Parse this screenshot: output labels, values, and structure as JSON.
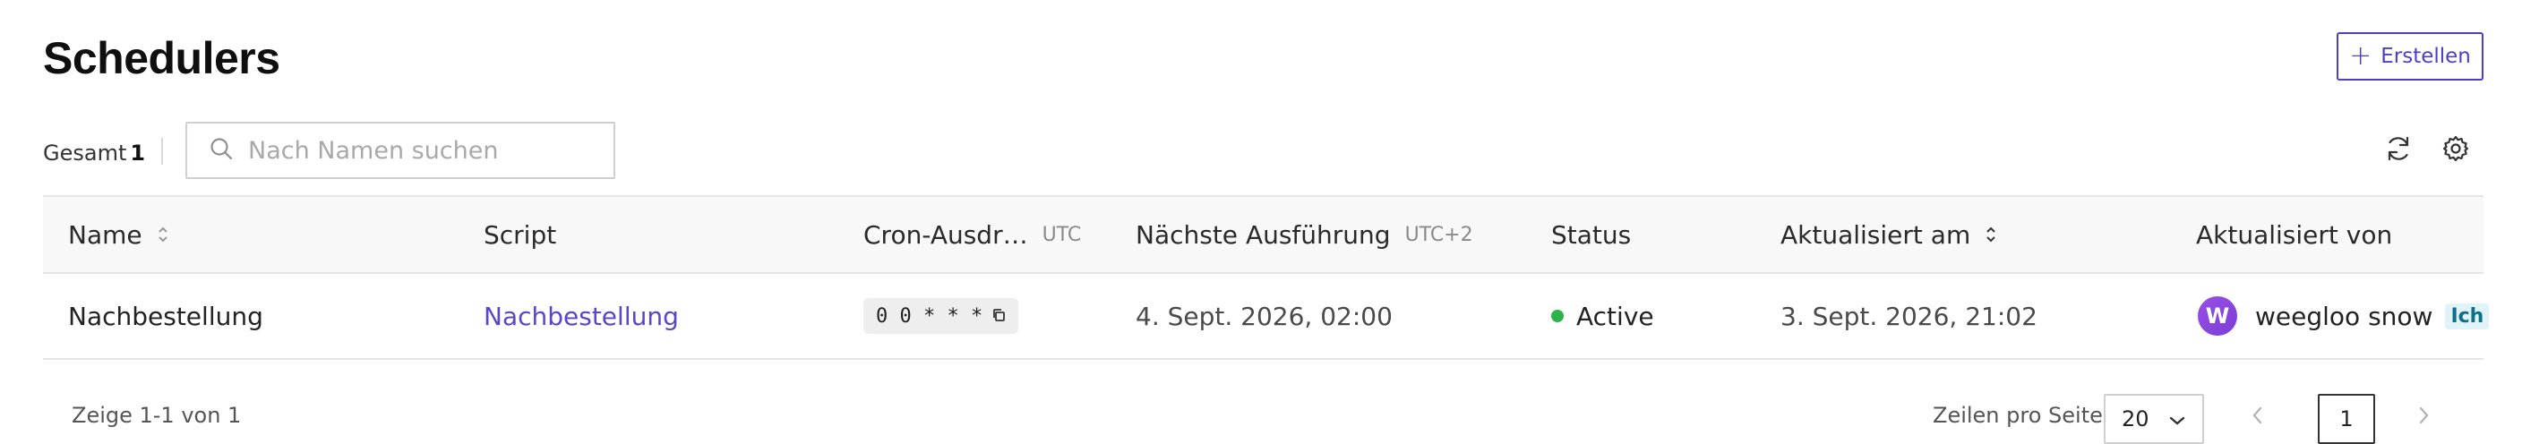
{
  "header": {
    "title": "Schedulers",
    "create_label": "Erstellen"
  },
  "toolbar": {
    "total_label": "Gesamt",
    "total_count": "1",
    "search_placeholder": "Nach Namen suchen",
    "search_value": ""
  },
  "table": {
    "columns": {
      "name": "Name",
      "script": "Script",
      "cron": "Cron-Ausdr…",
      "cron_tz": "UTC",
      "next_run": "Nächste Ausführung",
      "next_run_tz": "UTC+2",
      "status": "Status",
      "updated_at": "Aktualisiert am",
      "updated_by": "Aktualisiert von"
    },
    "rows": [
      {
        "name": "Nachbestellung",
        "script": "Nachbestellung",
        "cron": "0 0 * * *",
        "next_run": "4. Sept. 2026, 02:00",
        "status": "Active",
        "updated_at": "3. Sept. 2026, 21:02",
        "updated_by": "weegloo snow",
        "avatar_letter": "W",
        "me_badge": "Ich"
      }
    ]
  },
  "footer": {
    "range_text": "Zeige 1-1 von 1",
    "rows_per_page_label": "Zeilen pro Seite",
    "rows_per_page_value": "20",
    "current_page": "1"
  },
  "colors": {
    "accent": "#4b3fc7",
    "status_active": "#2db34a",
    "badge_bg": "#dff3f8"
  },
  "icons": [
    "plus-icon",
    "search-icon",
    "refresh-icon",
    "gear-icon",
    "sort-icon",
    "copy-icon",
    "chevron-down-icon",
    "chevron-left-icon",
    "chevron-right-icon"
  ]
}
